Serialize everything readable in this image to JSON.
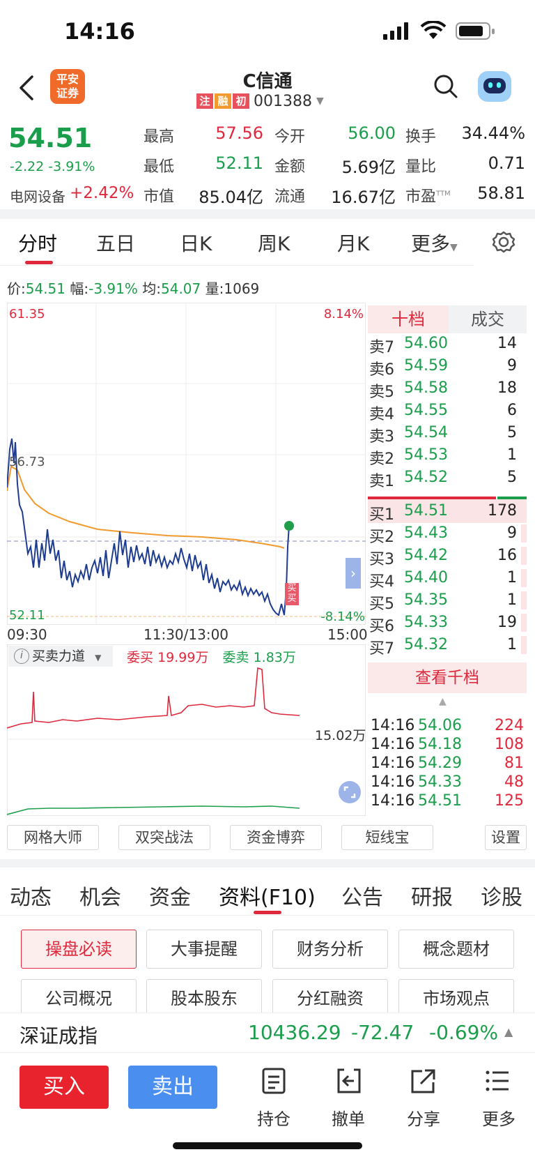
{
  "status": {
    "time": "14:16"
  },
  "header": {
    "title": "C信通",
    "badges": [
      "注",
      "融",
      "初"
    ],
    "code": "001388",
    "logo_text": "平安证券"
  },
  "quote": {
    "price": "54.51",
    "change": "-2.22",
    "pct": "-3.91%",
    "sector": "电网设备",
    "sector_pct": "+2.42%",
    "fields": [
      {
        "label": "最高",
        "value": "57.56",
        "color": "red"
      },
      {
        "label": "今开",
        "value": "56.00",
        "color": "green"
      },
      {
        "label": "换手",
        "value": "34.44%",
        "color": "black"
      },
      {
        "label": "最低",
        "value": "52.11",
        "color": "green"
      },
      {
        "label": "金额",
        "value": "5.69亿",
        "color": "black"
      },
      {
        "label": "量比",
        "value": "0.71",
        "color": "black"
      },
      {
        "label": "市值",
        "value": "85.04亿",
        "color": "black"
      },
      {
        "label": "流通",
        "value": "16.67亿",
        "color": "black"
      },
      {
        "label": "市盈",
        "value": "58.81",
        "color": "black",
        "sup": "TTM"
      }
    ]
  },
  "ktabs": [
    "分时",
    "五日",
    "日K",
    "周K",
    "月K",
    "更多"
  ],
  "infoline": {
    "price_label": "价:",
    "price": "54.51",
    "amp_label": "幅:",
    "amp": "-3.91%",
    "avg_label": "均:",
    "avg": "54.07",
    "vol_label": "量:",
    "vol": "1069"
  },
  "chart": {
    "y_top": "61.35",
    "y_mid": "56.73",
    "y_bot": "52.11",
    "pct_top": "8.14%",
    "pct_bot": "-8.14%",
    "x_labels": [
      "09:30",
      "11:30/13:00",
      "15:00"
    ],
    "buy_marker": "买",
    "indicator": "买卖力道",
    "wbuy_label": "委买",
    "wbuy": "19.99万",
    "wsell_label": "委卖",
    "wsell": "1.83万",
    "vol_label": "15.02万"
  },
  "orderbook": {
    "tabs": [
      "十档",
      "成交"
    ],
    "asks": [
      {
        "label": "卖7",
        "price": "54.60",
        "vol": "14"
      },
      {
        "label": "卖6",
        "price": "54.59",
        "vol": "9"
      },
      {
        "label": "卖5",
        "price": "54.58",
        "vol": "18"
      },
      {
        "label": "卖4",
        "price": "54.55",
        "vol": "6"
      },
      {
        "label": "卖3",
        "price": "54.54",
        "vol": "5"
      },
      {
        "label": "卖2",
        "price": "54.53",
        "vol": "1"
      },
      {
        "label": "卖1",
        "price": "54.52",
        "vol": "5"
      }
    ],
    "bids": [
      {
        "label": "买1",
        "price": "54.51",
        "vol": "178"
      },
      {
        "label": "买2",
        "price": "54.43",
        "vol": "9"
      },
      {
        "label": "买3",
        "price": "54.42",
        "vol": "16"
      },
      {
        "label": "买4",
        "price": "54.40",
        "vol": "1"
      },
      {
        "label": "买5",
        "price": "54.35",
        "vol": "1"
      },
      {
        "label": "买6",
        "price": "54.33",
        "vol": "19"
      },
      {
        "label": "买7",
        "price": "54.32",
        "vol": "1"
      }
    ],
    "more": "查看千档",
    "trades": [
      {
        "time": "14:16",
        "price": "54.06",
        "vol": "224"
      },
      {
        "time": "14:16",
        "price": "54.18",
        "vol": "108"
      },
      {
        "time": "14:16",
        "price": "54.29",
        "vol": "81"
      },
      {
        "time": "14:16",
        "price": "54.33",
        "vol": "48"
      },
      {
        "time": "14:16",
        "price": "54.51",
        "vol": "125"
      }
    ]
  },
  "tools": [
    "网格大师",
    "双突战法",
    "资金博弈",
    "短线宝",
    "设置"
  ],
  "f10tabs": [
    "动态",
    "机会",
    "资金",
    "资料(F10)",
    "公告",
    "研报",
    "诊股"
  ],
  "f10buttons": [
    "操盘必读",
    "大事提醒",
    "财务分析",
    "概念题材",
    "公司概况",
    "股本股东",
    "分红融资",
    "市场观点"
  ],
  "index": {
    "name": "深证成指",
    "value": "10436.29",
    "change": "-72.47",
    "pct": "-0.69%"
  },
  "bottom": {
    "buy": "买入",
    "sell": "卖出",
    "hold": "持仓",
    "cancel": "撤单",
    "share": "分享",
    "more": "更多"
  }
}
